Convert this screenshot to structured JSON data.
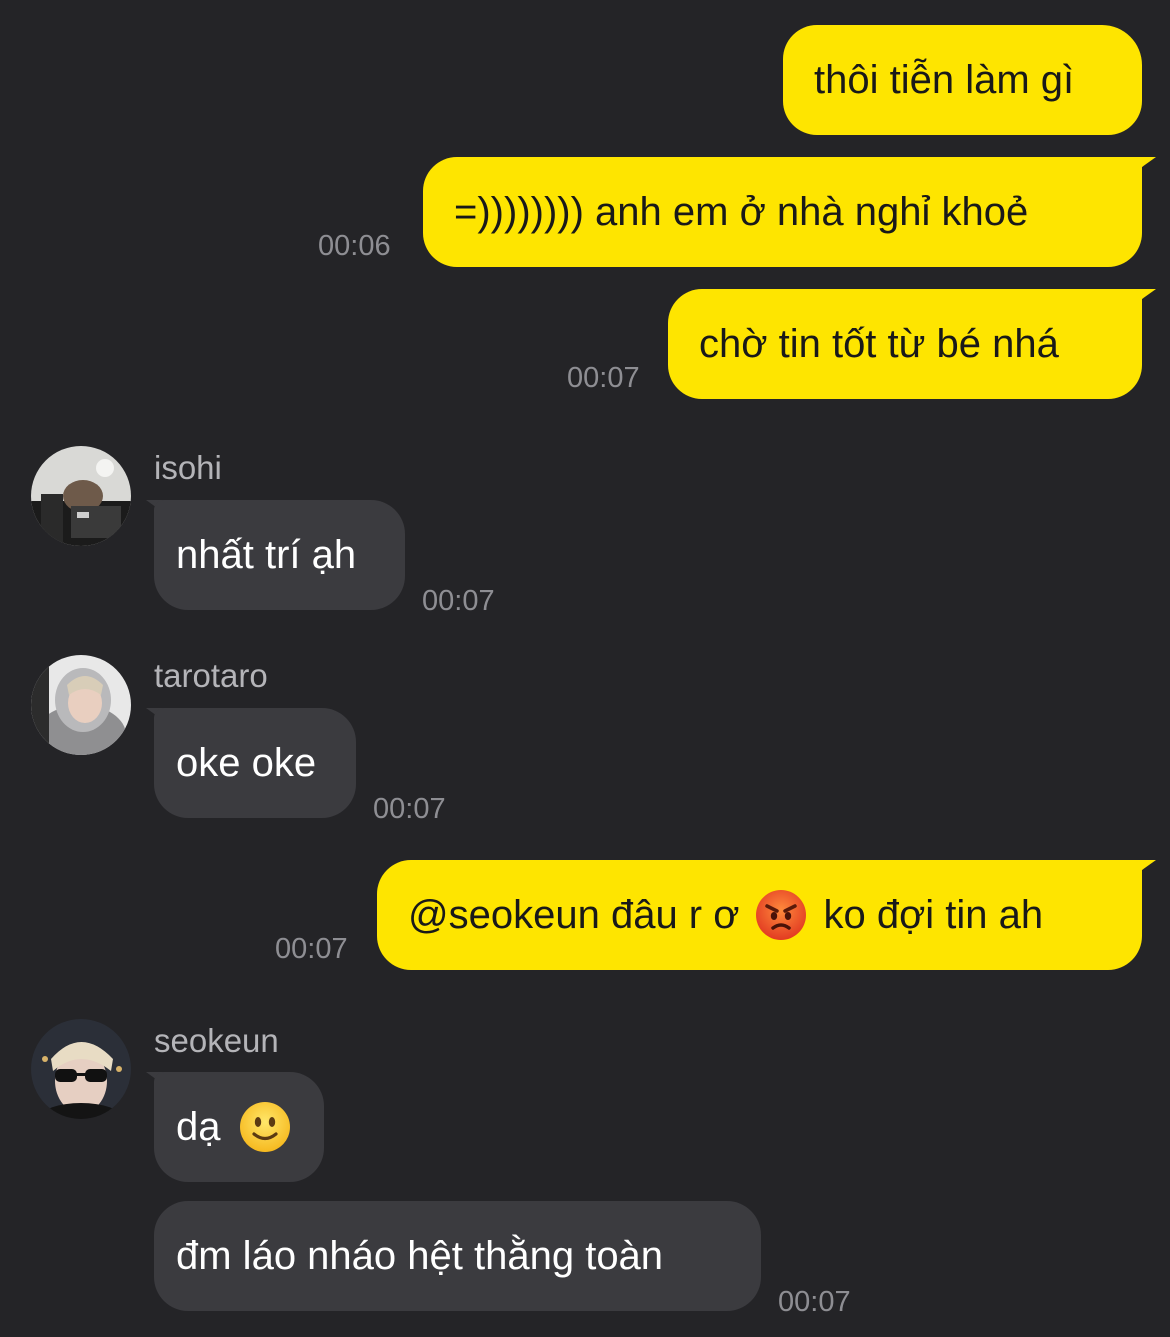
{
  "messages": [
    {
      "type": "outgoing",
      "text": "thôi tiễn làm gì"
    },
    {
      "type": "outgoing",
      "text": "=)))))))) anh em ở nhà nghỉ khoẻ",
      "time": "00:06"
    },
    {
      "type": "outgoing",
      "text": "chờ tin tốt từ bé nhá",
      "time": "00:07"
    },
    {
      "type": "incoming",
      "sender": "isohi",
      "text": "nhất trí ạh",
      "time": "00:07"
    },
    {
      "type": "incoming",
      "sender": "tarotaro",
      "text": "oke oke",
      "time": "00:07"
    },
    {
      "type": "outgoing",
      "text_before": "@seokeun đâu r ơ",
      "emoji": "angry-face-emoji",
      "text_after": "ko đợi tin ah",
      "time": "00:07"
    },
    {
      "type": "incoming",
      "sender": "seokeun",
      "text": "dạ",
      "emoji": "slightly-smiling-face-emoji"
    },
    {
      "type": "incoming",
      "text": "đm láo nháo hệt thằng toàn",
      "time": "00:07"
    }
  ],
  "colors": {
    "background": "#242427",
    "outgoing_bubble": "#fee500",
    "incoming_bubble": "#3b3b3f",
    "timestamp": "#8e8e93",
    "sender_name": "#b4b4b8"
  }
}
